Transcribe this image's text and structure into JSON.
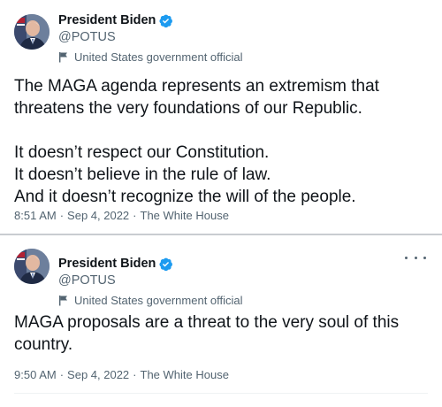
{
  "tweets": [
    {
      "author_name": "President Biden",
      "author_handle": "@POTUS",
      "account_label": "United States government official",
      "text": "The MAGA agenda represents an extremism that threatens the very foundations of our Republic.\n\nIt doesn’t respect our Constitution.\nIt doesn’t believe in the rule of law.\nAnd it doesn’t recognize the will of the people.",
      "time": "8:51 AM",
      "date": "Sep 4, 2022",
      "source": "The White House",
      "separator": "·"
    },
    {
      "author_name": "President Biden",
      "author_handle": "@POTUS",
      "account_label": "United States government official",
      "text": "MAGA proposals are a threat to the very soul of this country.",
      "time": "9:50 AM",
      "date": "Sep 4, 2022",
      "source": "The White House",
      "separator": "·"
    }
  ],
  "icons": {
    "verified": "verified-badge-icon",
    "label": "flag-icon",
    "more": "more-options-icon"
  },
  "colors": {
    "verified_blue": "#1d9bf0",
    "secondary_text": "#536471",
    "primary_text": "#0f1419",
    "divider": "#c9ccd1"
  }
}
